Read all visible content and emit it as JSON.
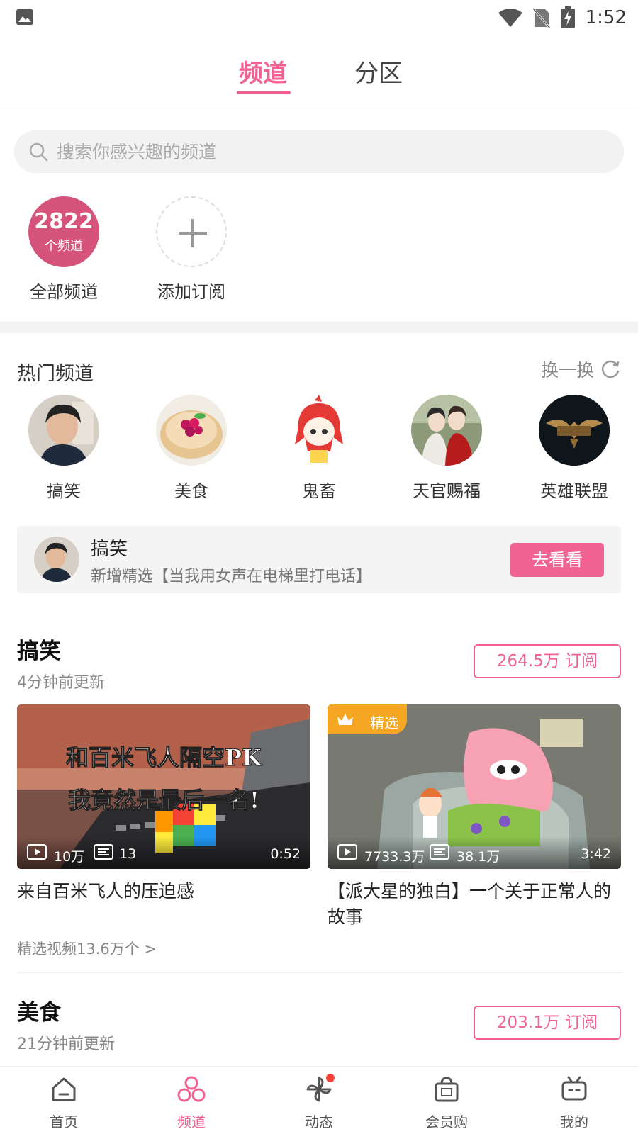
{
  "status_bar": {
    "time": "1:52"
  },
  "top_tabs": {
    "active": "频道",
    "inactive": "分区"
  },
  "search": {
    "placeholder": "搜索你感兴趣的频道"
  },
  "my_channels": {
    "all": {
      "count": "2822",
      "unit": "个频道",
      "label": "全部频道"
    },
    "add": {
      "label": "添加订阅"
    }
  },
  "hot": {
    "title": "热门频道",
    "refresh_label": "换一换",
    "items": [
      {
        "label": "搞笑"
      },
      {
        "label": "美食"
      },
      {
        "label": "鬼畜"
      },
      {
        "label": "天官赐福"
      },
      {
        "label": "英雄联盟"
      }
    ]
  },
  "update_card": {
    "name": "搞笑",
    "desc": "新增精选【当我用女声在电梯里打电话】",
    "button": "去看看"
  },
  "sections": [
    {
      "title": "搞笑",
      "updated": "4分钟前更新",
      "subscribe": "264.5万 订阅",
      "videos": [
        {
          "plays": "10万",
          "danmaku": "13",
          "duration": "0:52",
          "title": "来自百米飞人的压迫感",
          "overlay_line1": "和百米飞人隔空PK",
          "overlay_line2": "我竟然是最后一名!"
        },
        {
          "featured": "精选",
          "plays": "7733.3万",
          "danmaku": "38.1万",
          "duration": "3:42",
          "title": "【派大星的独白】一个关于正常人的故事"
        }
      ],
      "more": "精选视频13.6万个 >"
    },
    {
      "title": "美食",
      "updated": "21分钟前更新",
      "subscribe": "203.1万 订阅"
    }
  ],
  "bottom_nav": {
    "items": [
      {
        "label": "首页"
      },
      {
        "label": "频道"
      },
      {
        "label": "动态"
      },
      {
        "label": "会员购"
      },
      {
        "label": "我的"
      }
    ]
  }
}
